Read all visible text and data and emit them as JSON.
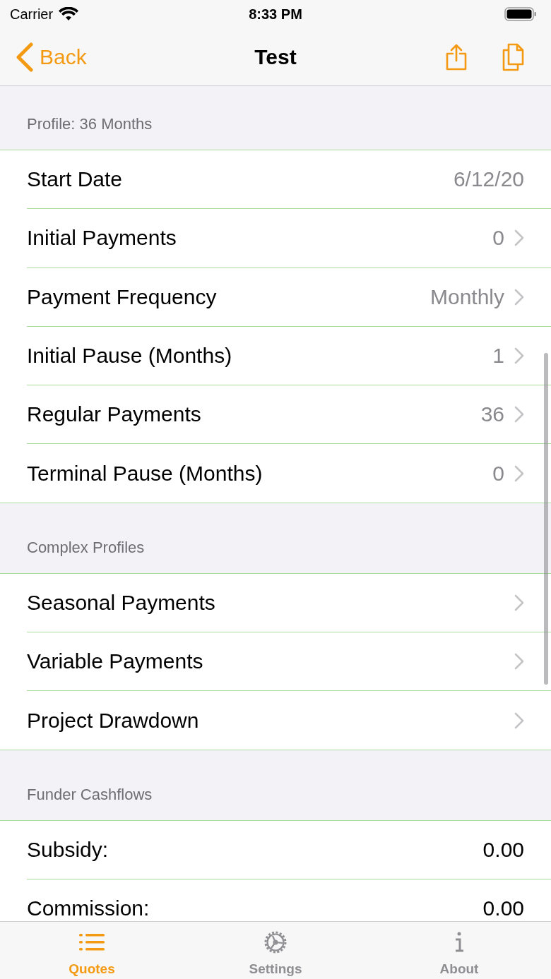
{
  "status_bar": {
    "carrier": "Carrier",
    "time": "8:33 PM"
  },
  "nav": {
    "back": "Back",
    "title": "Test"
  },
  "sections": [
    {
      "header": "Profile: 36 Months",
      "rows": [
        {
          "label": "Start Date",
          "value": "6/12/20",
          "chevron": false
        },
        {
          "label": "Initial Payments",
          "value": "0",
          "chevron": true
        },
        {
          "label": "Payment Frequency",
          "value": "Monthly",
          "chevron": true
        },
        {
          "label": "Initial Pause (Months)",
          "value": "1",
          "chevron": true
        },
        {
          "label": "Regular Payments",
          "value": "36",
          "chevron": true
        },
        {
          "label": "Terminal Pause (Months)",
          "value": "0",
          "chevron": true
        }
      ]
    },
    {
      "header": "Complex Profiles",
      "rows": [
        {
          "label": "Seasonal Payments",
          "chevron": true
        },
        {
          "label": "Variable Payments",
          "chevron": true
        },
        {
          "label": "Project Drawdown",
          "chevron": true
        }
      ]
    },
    {
      "header": "Funder Cashflows",
      "rows": [
        {
          "label": "Subsidy:",
          "value": "0.00",
          "chevron": false,
          "value_dark": true
        },
        {
          "label": "Commission:",
          "value": "0.00",
          "chevron": false,
          "value_dark": true
        }
      ]
    }
  ],
  "tabs": [
    {
      "label": "Quotes",
      "kind": "list",
      "selected": true
    },
    {
      "label": "Settings",
      "kind": "gear",
      "selected": false
    },
    {
      "label": "About",
      "kind": "info",
      "selected": false
    }
  ]
}
